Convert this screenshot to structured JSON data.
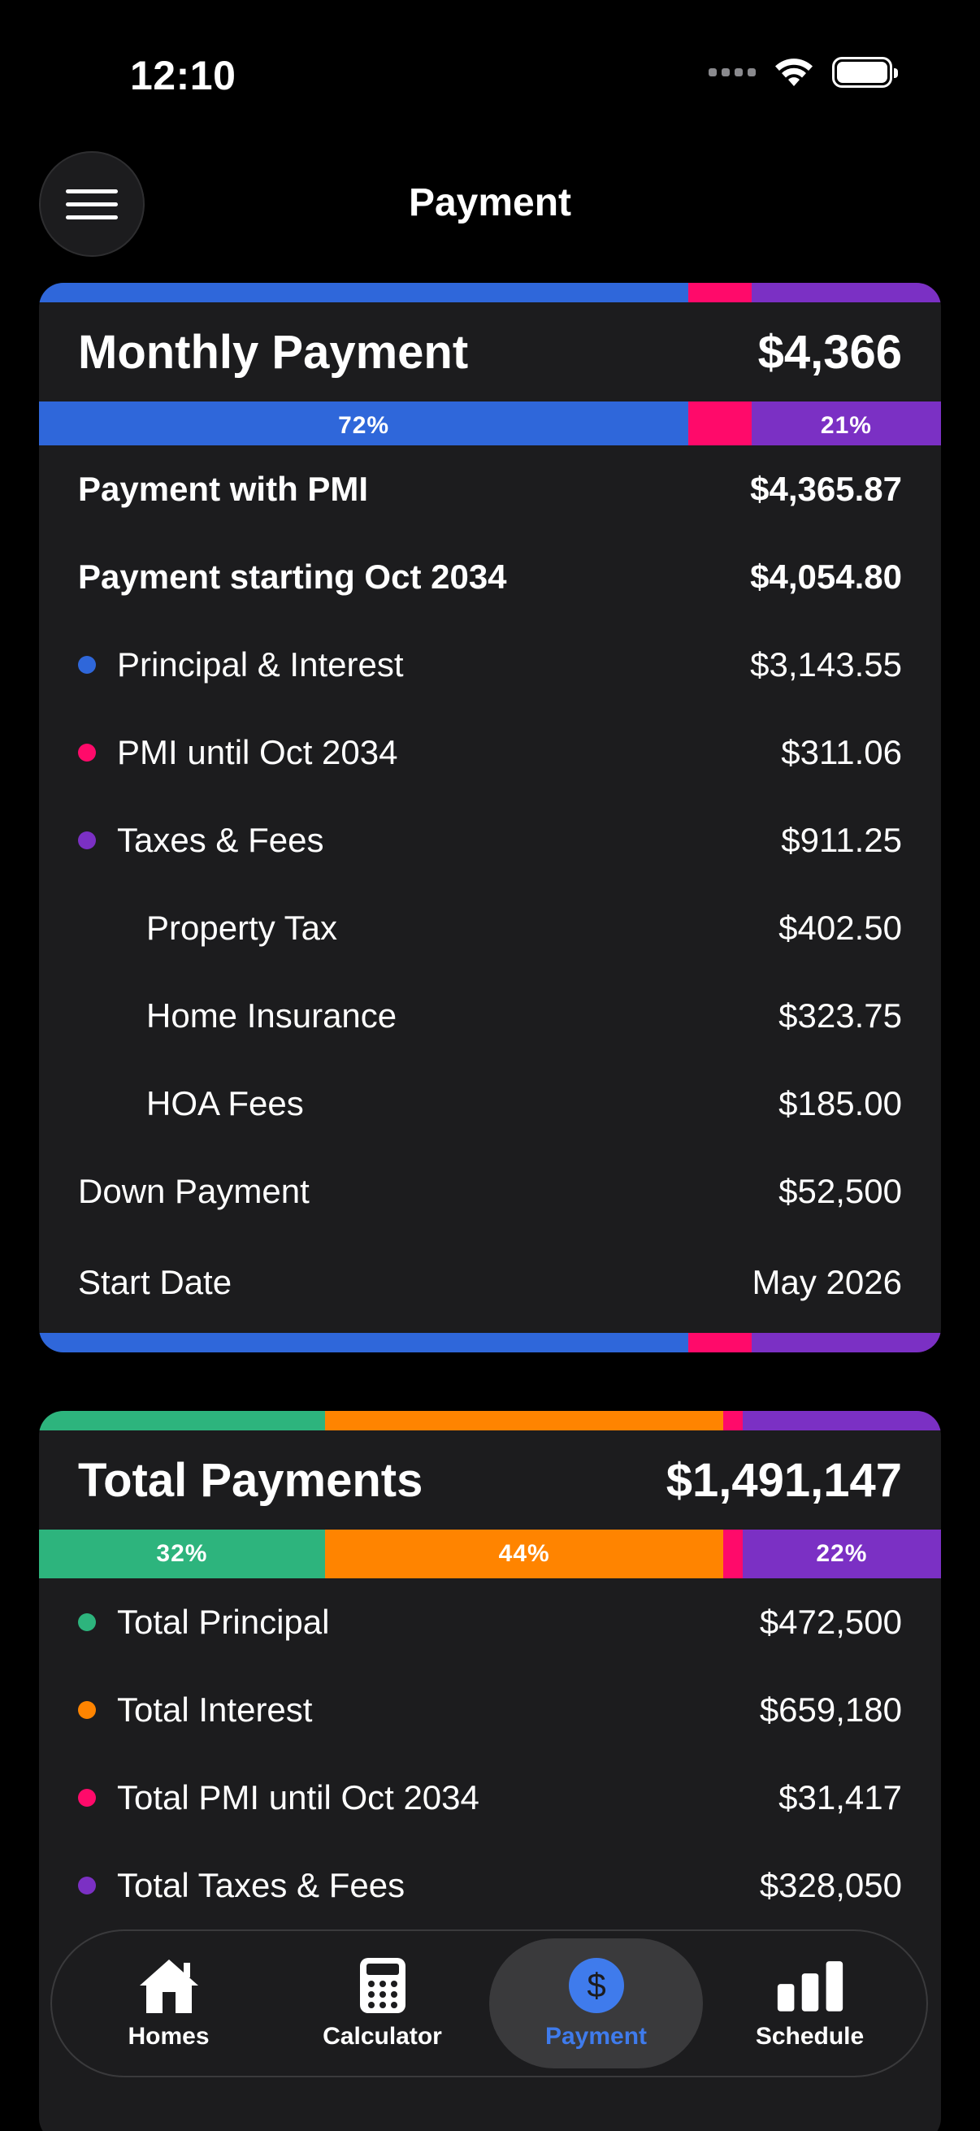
{
  "status": {
    "time": "12:10"
  },
  "nav": {
    "title": "Payment"
  },
  "colors": {
    "blue": "#2f67da",
    "pink": "#ff0a6a",
    "purple": "#7b30c4",
    "green": "#2db47d",
    "orange": "#ff8400"
  },
  "monthly": {
    "title": "Monthly Payment",
    "total": "$4,366",
    "pct_blue": "72%",
    "pct_purple": "21%",
    "rows": [
      {
        "label": "Payment with PMI",
        "value": "$4,365.87"
      },
      {
        "label": "Payment starting Oct 2034",
        "value": "$4,054.80"
      },
      {
        "label": "Principal & Interest",
        "value": "$3,143.55"
      },
      {
        "label": "PMI until Oct 2034",
        "value": "$311.06"
      },
      {
        "label": "Taxes & Fees",
        "value": "$911.25"
      },
      {
        "label": "Property Tax",
        "value": "$402.50"
      },
      {
        "label": "Home Insurance",
        "value": "$323.75"
      },
      {
        "label": "HOA Fees",
        "value": "$185.00"
      },
      {
        "label": "Down Payment",
        "value": "$52,500"
      },
      {
        "label": "Start Date",
        "value": "May 2026"
      }
    ]
  },
  "totals": {
    "title": "Total Payments",
    "total": "$1,491,147",
    "pct_green": "32%",
    "pct_orange": "44%",
    "pct_purple": "22%",
    "rows": [
      {
        "label": "Total Principal",
        "value": "$472,500"
      },
      {
        "label": "Total Interest",
        "value": "$659,180"
      },
      {
        "label": "Total PMI until Oct 2034",
        "value": "$31,417"
      },
      {
        "label": "Total Taxes & Fees",
        "value": "$328,050"
      }
    ]
  },
  "tabs": [
    {
      "label": "Homes",
      "icon": "house-icon"
    },
    {
      "label": "Calculator",
      "icon": "calculator-icon"
    },
    {
      "label": "Payment",
      "icon": "dollar-icon",
      "active": true
    },
    {
      "label": "Schedule",
      "icon": "bar-chart-icon"
    }
  ]
}
